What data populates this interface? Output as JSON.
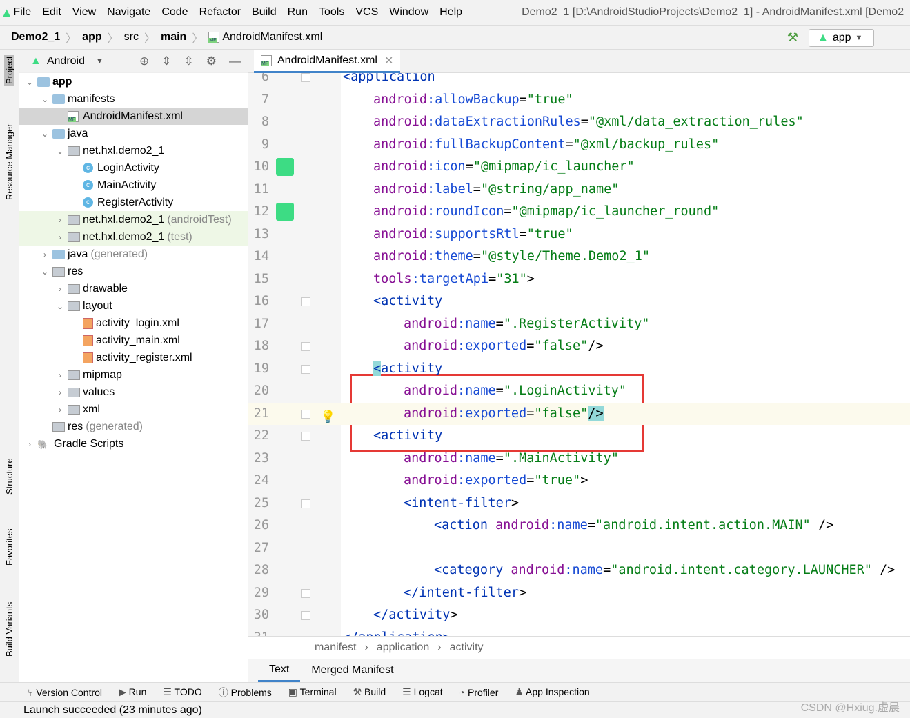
{
  "menu": [
    "File",
    "Edit",
    "View",
    "Navigate",
    "Code",
    "Refactor",
    "Build",
    "Run",
    "Tools",
    "VCS",
    "Window",
    "Help"
  ],
  "window_title": "Demo2_1 [D:\\AndroidStudioProjects\\Demo2_1] - AndroidManifest.xml [Demo2_",
  "breadcrumb": [
    "Demo2_1",
    "app",
    "src",
    "main",
    "AndroidManifest.xml"
  ],
  "run_config": "app",
  "side_tabs": [
    "Project",
    "Resource Manager",
    "Structure",
    "Favorites",
    "Build Variants"
  ],
  "project_view": "Android",
  "tree": [
    {
      "label": "app",
      "depth": 0,
      "arrow": "v",
      "icon": "folder",
      "bold": true
    },
    {
      "label": "manifests",
      "depth": 1,
      "arrow": "v",
      "icon": "folder"
    },
    {
      "label": "AndroidManifest.xml",
      "depth": 2,
      "arrow": "",
      "icon": "mf",
      "sel": true
    },
    {
      "label": "java",
      "depth": 1,
      "arrow": "v",
      "icon": "folder"
    },
    {
      "label": "net.hxl.demo2_1",
      "depth": 2,
      "arrow": "v",
      "icon": "pkg"
    },
    {
      "label": "LoginActivity",
      "depth": 3,
      "arrow": "",
      "icon": "cls"
    },
    {
      "label": "MainActivity",
      "depth": 3,
      "arrow": "",
      "icon": "cls"
    },
    {
      "label": "RegisterActivity",
      "depth": 3,
      "arrow": "",
      "icon": "cls"
    },
    {
      "label": "net.hxl.demo2_1",
      "suffix": "(androidTest)",
      "depth": 2,
      "arrow": ">",
      "icon": "pkg",
      "green": true
    },
    {
      "label": "net.hxl.demo2_1",
      "suffix": "(test)",
      "depth": 2,
      "arrow": ">",
      "icon": "pkg",
      "green": true
    },
    {
      "label": "java",
      "suffix": "(generated)",
      "depth": 1,
      "arrow": ">",
      "icon": "folder"
    },
    {
      "label": "res",
      "depth": 1,
      "arrow": "v",
      "icon": "pkg"
    },
    {
      "label": "drawable",
      "depth": 2,
      "arrow": ">",
      "icon": "pkg"
    },
    {
      "label": "layout",
      "depth": 2,
      "arrow": "v",
      "icon": "pkg"
    },
    {
      "label": "activity_login.xml",
      "depth": 3,
      "arrow": "",
      "icon": "xml"
    },
    {
      "label": "activity_main.xml",
      "depth": 3,
      "arrow": "",
      "icon": "xml"
    },
    {
      "label": "activity_register.xml",
      "depth": 3,
      "arrow": "",
      "icon": "xml"
    },
    {
      "label": "mipmap",
      "depth": 2,
      "arrow": ">",
      "icon": "pkg"
    },
    {
      "label": "values",
      "depth": 2,
      "arrow": ">",
      "icon": "pkg"
    },
    {
      "label": "xml",
      "depth": 2,
      "arrow": ">",
      "icon": "pkg"
    },
    {
      "label": "res",
      "suffix": "(generated)",
      "depth": 1,
      "arrow": "",
      "icon": "pkg"
    },
    {
      "label": "Gradle Scripts",
      "depth": 0,
      "arrow": ">",
      "icon": "gradle"
    }
  ],
  "editor_tab": "AndroidManifest.xml",
  "code": [
    {
      "n": 6,
      "i": 1,
      "tok": [
        [
          "t",
          "<application"
        ]
      ]
    },
    {
      "n": 7,
      "i": 2,
      "tok": [
        [
          "ns",
          "android"
        ],
        [
          "at",
          ":allowBackup"
        ],
        [
          "p",
          "="
        ],
        [
          "v",
          "\"true\""
        ]
      ]
    },
    {
      "n": 8,
      "i": 2,
      "tok": [
        [
          "ns",
          "android"
        ],
        [
          "at",
          ":dataExtractionRules"
        ],
        [
          "p",
          "="
        ],
        [
          "v",
          "\"@xml/data_extraction_rules\""
        ]
      ]
    },
    {
      "n": 9,
      "i": 2,
      "tok": [
        [
          "ns",
          "android"
        ],
        [
          "at",
          ":fullBackupContent"
        ],
        [
          "p",
          "="
        ],
        [
          "v",
          "\"@xml/backup_rules\""
        ]
      ]
    },
    {
      "n": 10,
      "i": 2,
      "tok": [
        [
          "ns",
          "android"
        ],
        [
          "at",
          ":icon"
        ],
        [
          "p",
          "="
        ],
        [
          "v",
          "\"@mipmap/ic_launcher\""
        ]
      ]
    },
    {
      "n": 11,
      "i": 2,
      "tok": [
        [
          "ns",
          "android"
        ],
        [
          "at",
          ":label"
        ],
        [
          "p",
          "="
        ],
        [
          "v",
          "\"@string/app_name\""
        ]
      ]
    },
    {
      "n": 12,
      "i": 2,
      "tok": [
        [
          "ns",
          "android"
        ],
        [
          "at",
          ":roundIcon"
        ],
        [
          "p",
          "="
        ],
        [
          "v",
          "\"@mipmap/ic_launcher_round\""
        ]
      ]
    },
    {
      "n": 13,
      "i": 2,
      "tok": [
        [
          "ns",
          "android"
        ],
        [
          "at",
          ":supportsRtl"
        ],
        [
          "p",
          "="
        ],
        [
          "v",
          "\"true\""
        ]
      ]
    },
    {
      "n": 14,
      "i": 2,
      "tok": [
        [
          "ns",
          "android"
        ],
        [
          "at",
          ":theme"
        ],
        [
          "p",
          "="
        ],
        [
          "v",
          "\"@style/Theme.Demo2_1\""
        ]
      ]
    },
    {
      "n": 15,
      "i": 2,
      "tok": [
        [
          "ns",
          "tools"
        ],
        [
          "at",
          ":targetApi"
        ],
        [
          "p",
          "="
        ],
        [
          "v",
          "\"31\""
        ],
        [
          "p",
          ">"
        ]
      ]
    },
    {
      "n": 16,
      "i": 2,
      "tok": [
        [
          "t",
          "<activity"
        ]
      ]
    },
    {
      "n": 17,
      "i": 3,
      "tok": [
        [
          "ns",
          "android"
        ],
        [
          "at",
          ":name"
        ],
        [
          "p",
          "="
        ],
        [
          "v",
          "\".RegisterActivity\""
        ]
      ]
    },
    {
      "n": 18,
      "i": 3,
      "tok": [
        [
          "ns",
          "android"
        ],
        [
          "at",
          ":exported"
        ],
        [
          "p",
          "="
        ],
        [
          "v",
          "\"false\""
        ],
        [
          "p",
          "/>"
        ]
      ]
    },
    {
      "n": 19,
      "i": 2,
      "tok": [
        [
          "t hl",
          "<"
        ],
        [
          "t",
          "activity"
        ]
      ]
    },
    {
      "n": 20,
      "i": 3,
      "tok": [
        [
          "ns",
          "android"
        ],
        [
          "at",
          ":name"
        ],
        [
          "p",
          "="
        ],
        [
          "v",
          "\".LoginActivity\""
        ]
      ]
    },
    {
      "n": 21,
      "i": 3,
      "tok": [
        [
          "ns",
          "android"
        ],
        [
          "at",
          ":exported"
        ],
        [
          "p",
          "="
        ],
        [
          "v",
          "\"false\""
        ],
        [
          "p hl",
          "/>"
        ]
      ]
    },
    {
      "n": 22,
      "i": 2,
      "tok": [
        [
          "t",
          "<activity"
        ]
      ]
    },
    {
      "n": 23,
      "i": 3,
      "tok": [
        [
          "ns",
          "android"
        ],
        [
          "at",
          ":name"
        ],
        [
          "p",
          "="
        ],
        [
          "v",
          "\".MainActivity\""
        ]
      ]
    },
    {
      "n": 24,
      "i": 3,
      "tok": [
        [
          "ns",
          "android"
        ],
        [
          "at",
          ":exported"
        ],
        [
          "p",
          "="
        ],
        [
          "v",
          "\"true\""
        ],
        [
          "p",
          ">"
        ]
      ]
    },
    {
      "n": 25,
      "i": 3,
      "tok": [
        [
          "t",
          "<intent-filter"
        ],
        [
          "p",
          ">"
        ]
      ]
    },
    {
      "n": 26,
      "i": 4,
      "tok": [
        [
          "t",
          "<action "
        ],
        [
          "ns",
          "android"
        ],
        [
          "at",
          ":name"
        ],
        [
          "p",
          "="
        ],
        [
          "v",
          "\"android.intent.action.MAIN\""
        ],
        [
          "p",
          " />"
        ]
      ]
    },
    {
      "n": 27,
      "i": 4,
      "tok": []
    },
    {
      "n": 28,
      "i": 4,
      "tok": [
        [
          "t",
          "<category "
        ],
        [
          "ns",
          "android"
        ],
        [
          "at",
          ":name"
        ],
        [
          "p",
          "="
        ],
        [
          "v",
          "\"android.intent.category.LAUNCHER\""
        ],
        [
          "p",
          " />"
        ]
      ]
    },
    {
      "n": 29,
      "i": 3,
      "tok": [
        [
          "t",
          "</intent-filter"
        ],
        [
          "p",
          ">"
        ]
      ]
    },
    {
      "n": 30,
      "i": 2,
      "tok": [
        [
          "t",
          "</activity"
        ],
        [
          "p",
          ">"
        ]
      ]
    },
    {
      "n": 31,
      "i": 1,
      "tok": [
        [
          "t",
          "</application>"
        ]
      ]
    }
  ],
  "editor_breadcrumb": [
    "manifest",
    "application",
    "activity"
  ],
  "editor_bottom_tabs": [
    "Text",
    "Merged Manifest"
  ],
  "tool_windows": [
    "Version Control",
    "Run",
    "TODO",
    "Problems",
    "Terminal",
    "Build",
    "Logcat",
    "Profiler",
    "App Inspection"
  ],
  "status": "Launch succeeded (23 minutes ago)",
  "watermark": "CSDN @Hxiug.虚晨"
}
